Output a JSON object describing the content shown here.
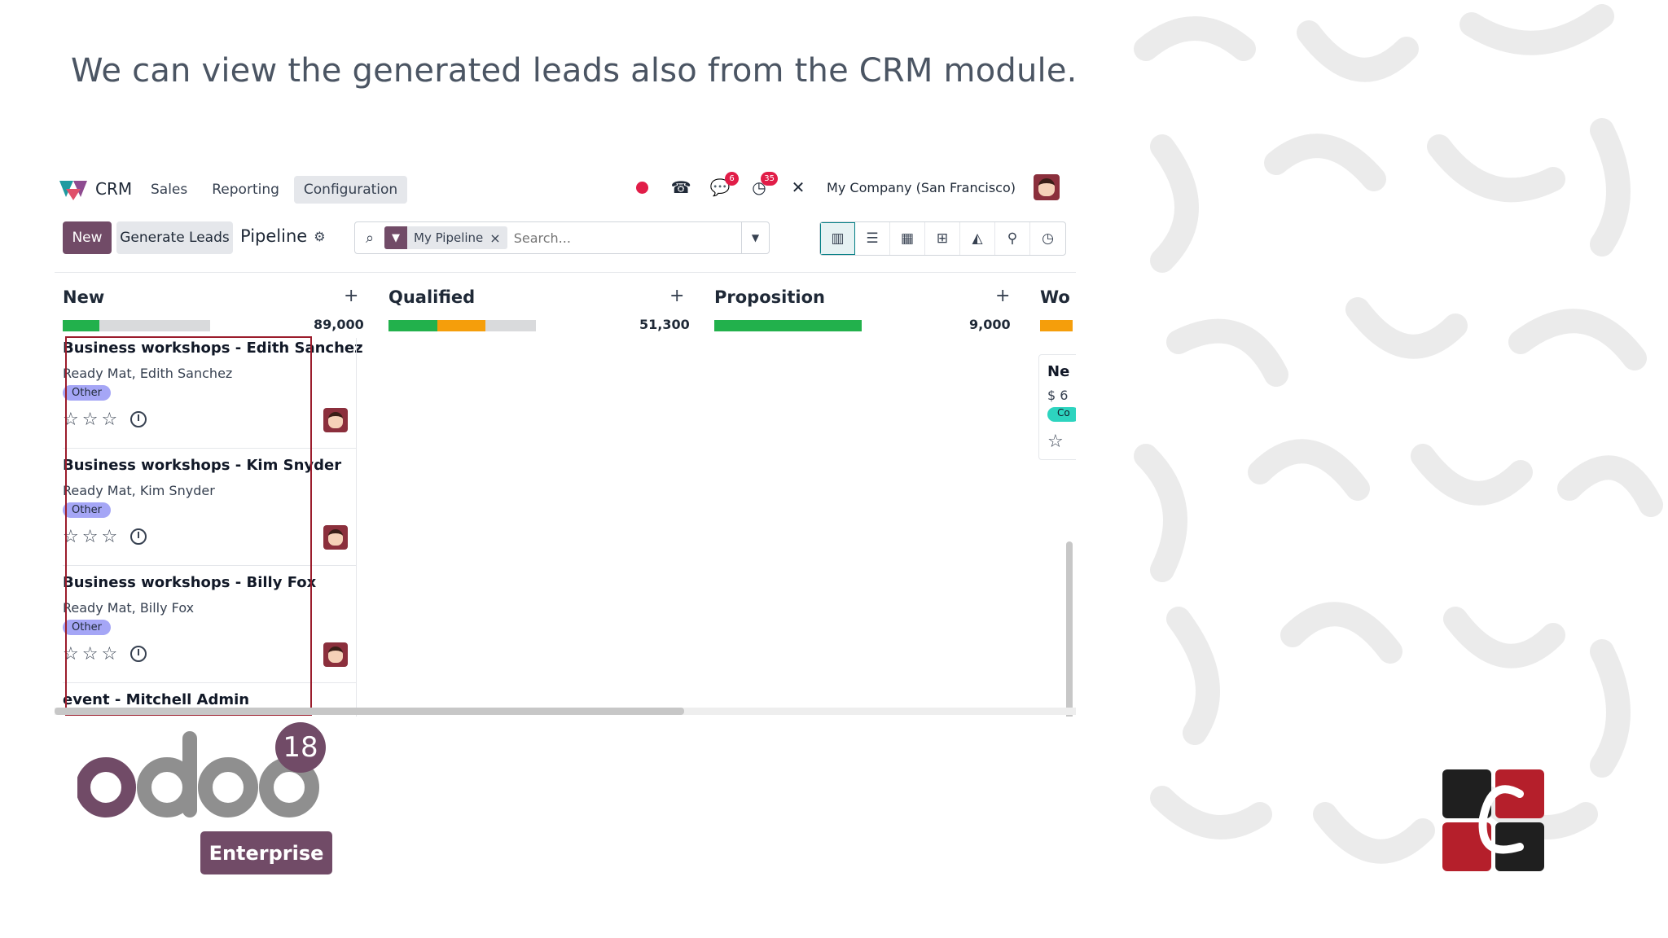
{
  "headline": "We can view the generated leads also from the CRM module.",
  "topbar": {
    "app_name": "CRM",
    "menu": [
      "Sales",
      "Reporting",
      "Configuration"
    ],
    "messages_badge": "6",
    "activities_badge": "35",
    "company": "My Company (San Francisco)"
  },
  "controlbar": {
    "new_label": "New",
    "generate_label": "Generate Leads",
    "breadcrumb": "Pipeline",
    "facet_label": "My Pipeline",
    "search_placeholder": "Search..."
  },
  "columns": [
    {
      "name": "New",
      "total": "89,000",
      "progress": {
        "green": 0.25,
        "orange": 0.0
      }
    },
    {
      "name": "Qualified",
      "total": "51,300",
      "progress": {
        "green": 0.33,
        "orange": 0.33
      }
    },
    {
      "name": "Proposition",
      "total": "9,000",
      "progress": {
        "green": 1.0,
        "orange": 0.0
      }
    },
    {
      "name": "Wo",
      "total": "",
      "progress": {
        "green": 0.0,
        "orange": 1.0
      }
    }
  ],
  "cards": [
    {
      "title": "Business workshops - Edith Sanchez",
      "subtitle": "Ready Mat, Edith Sanchez",
      "tag": "Other"
    },
    {
      "title": "Business workshops - Kim Snyder",
      "subtitle": "Ready Mat, Kim Snyder",
      "tag": "Other"
    },
    {
      "title": "Business workshops - Billy Fox",
      "subtitle": "Ready Mat, Billy Fox",
      "tag": "Other"
    },
    {
      "title": "event - Mitchell Admin",
      "subtitle": "",
      "tag": ""
    }
  ],
  "partial_card": {
    "title": "Ne",
    "amount": "$ 6",
    "tag": "Co"
  },
  "branding": {
    "odoo_version": "18",
    "edition": "Enterprise",
    "accent_color": "#714b67",
    "highlight_color": "#9b1c2c"
  }
}
